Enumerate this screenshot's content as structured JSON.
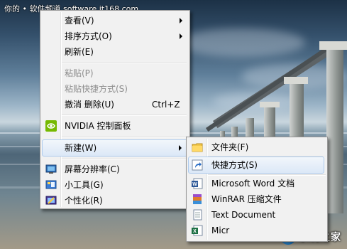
{
  "watermark": "你的 • 软件频道 software.it168.com",
  "site_logo": "系统之家",
  "context_menu": {
    "items": [
      {
        "label": "查看(V)"
      },
      {
        "label": "排序方式(O)"
      },
      {
        "label": "刷新(E)"
      },
      {
        "label": "粘贴(P)"
      },
      {
        "label": "粘贴快捷方式(S)"
      },
      {
        "label": "撤消 删除(U)",
        "shortcut": "Ctrl+Z"
      },
      {
        "label": "NVIDIA 控制面板"
      },
      {
        "label": "新建(W)"
      },
      {
        "label": "屏幕分辨率(C)"
      },
      {
        "label": "小工具(G)"
      },
      {
        "label": "个性化(R)"
      }
    ]
  },
  "new_submenu": {
    "items": [
      {
        "label": "文件夹(F)"
      },
      {
        "label": "快捷方式(S)"
      },
      {
        "label": "Microsoft Word 文档"
      },
      {
        "label": "WinRAR 压缩文件"
      },
      {
        "label": "Text Document"
      },
      {
        "label": "Micr"
      }
    ]
  },
  "colors": {
    "menu_bg": "#f1f1f1",
    "menu_border": "#979797",
    "highlight_border": "#aecbed",
    "disabled_text": "#8d8d8d"
  }
}
